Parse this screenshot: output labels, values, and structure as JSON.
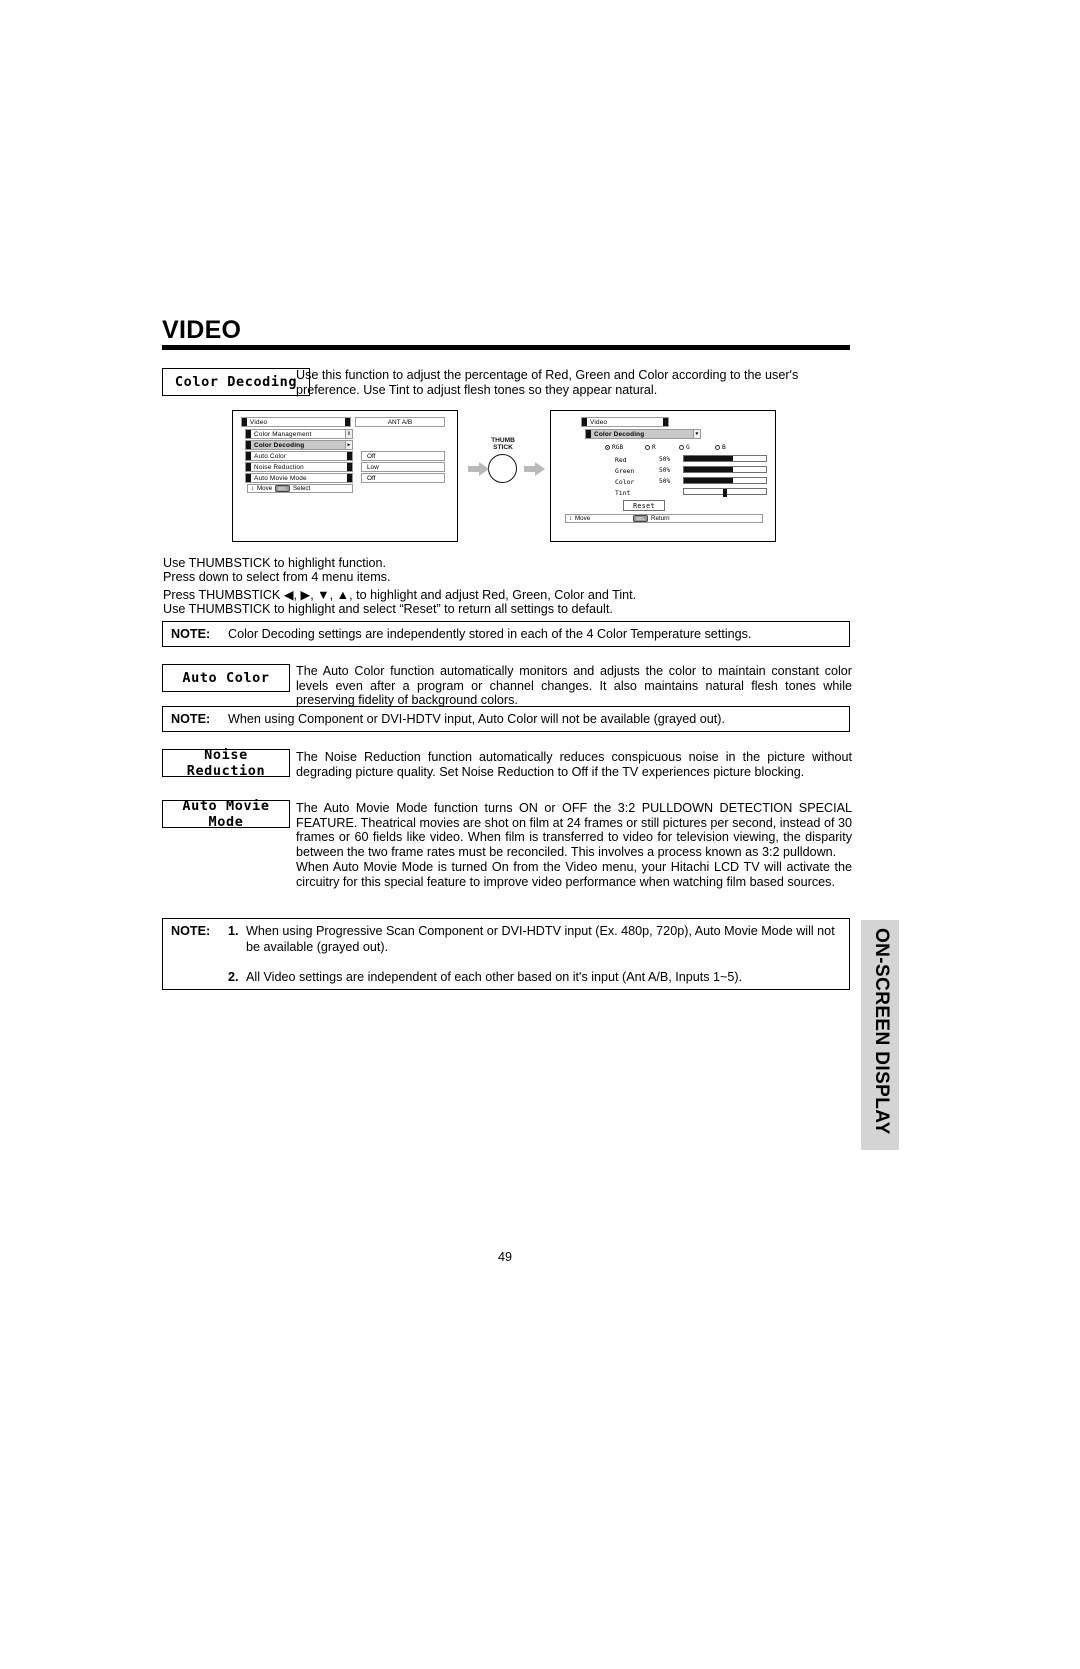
{
  "page": {
    "title": "VIDEO",
    "number": "49",
    "side_tab": "ON-SCREEN DISPLAY"
  },
  "sections": [
    {
      "label": "Color Decoding",
      "body": "Use this function to adjust the percentage of Red, Green and Color according to the user's preference.  Use Tint to adjust flesh tones so they appear natural."
    },
    {
      "label": "Auto Color",
      "body": "The Auto Color function automatically monitors and adjusts the color to maintain constant color levels even after a program or channel changes.  It also maintains natural flesh tones while preserving fidelity of background colors."
    },
    {
      "label": "Noise Reduction",
      "body": "The Noise Reduction function automatically reduces conspicuous noise in the picture without degrading picture quality.  Set Noise Reduction to Off if the TV experiences picture blocking."
    },
    {
      "label": "Auto Movie Mode",
      "body": "The Auto Movie Mode function turns ON or OFF the 3:2 PULLDOWN DETECTION SPECIAL FEATURE.  Theatrical movies are shot on film at 24 frames or still pictures per second, instead of 30 frames or 60 fields like video.  When film is transferred to video for television viewing, the disparity between the two frame rates must be reconciled.  This involves a process known as 3:2 pulldown.",
      "body2": "When Auto Movie Mode is turned On from the Video menu, your Hitachi LCD TV will activate the circuitry for this special feature to improve video performance when watching film based sources."
    }
  ],
  "instructions": {
    "line1": "Use THUMBSTICK to highlight function.",
    "line2": "Press down to select from 4 menu items.",
    "line3": "Press THUMBSTICK ◀, ▶, ▼, ▲, to highlight and adjust Red, Green, Color and Tint.",
    "line4": "Use THUMBSTICK to highlight and select “Reset” to return all settings to default."
  },
  "notes": [
    {
      "label": "NOTE:",
      "text": "Color Decoding settings are independently stored in each of the 4 Color Temperature settings."
    },
    {
      "label": "NOTE:",
      "text": "When using Component or DVI-HDTV input, Auto Color will not be available (grayed out)."
    }
  ],
  "note_list": {
    "label": "NOTE:",
    "items": [
      {
        "num": "1.",
        "text": "When using Progressive Scan Component or DVI-HDTV input (Ex. 480p, 720p), Auto Movie Mode will not be available (grayed out)."
      },
      {
        "num": "2.",
        "text": "All Video settings are independent of each other based on it's input (Ant A/B, Inputs 1~5)."
      }
    ]
  },
  "osd_left": {
    "title": "Video",
    "source": "ANT A/B",
    "rows": [
      {
        "label": "Color Management",
        "value": "",
        "highlight": false,
        "arrow": "⇕"
      },
      {
        "label": "Color Decoding",
        "value": "",
        "highlight": true,
        "arrow": "▸"
      },
      {
        "label": "Auto Color",
        "value": "Off",
        "highlight": false,
        "arrow": ""
      },
      {
        "label": "Noise Reduction",
        "value": "Low",
        "highlight": false,
        "arrow": ""
      },
      {
        "label": "Auto Movie Mode",
        "value": "Off",
        "highlight": false,
        "arrow": ""
      }
    ],
    "footer": {
      "move": "Move",
      "key": "SEL",
      "action": "Select"
    }
  },
  "osd_right": {
    "title": "Video",
    "menu": "Color Decoding",
    "radios": [
      {
        "label": "RGB",
        "selected": true
      },
      {
        "label": "R",
        "selected": false
      },
      {
        "label": "G",
        "selected": false
      },
      {
        "label": "B",
        "selected": false
      }
    ],
    "sliders": [
      {
        "label": "Red",
        "value": "50%",
        "fill": 60
      },
      {
        "label": "Green",
        "value": "50%",
        "fill": 60
      },
      {
        "label": "Color",
        "value": "50%",
        "fill": 60
      },
      {
        "label": "Tint",
        "value": "",
        "fill": 0,
        "knob": 50
      }
    ],
    "reset": "Reset",
    "footer": {
      "move": "Move",
      "key": "SEL",
      "action": "Return"
    }
  },
  "thumbstick": {
    "line1": "THUMB",
    "line2": "STICK"
  }
}
